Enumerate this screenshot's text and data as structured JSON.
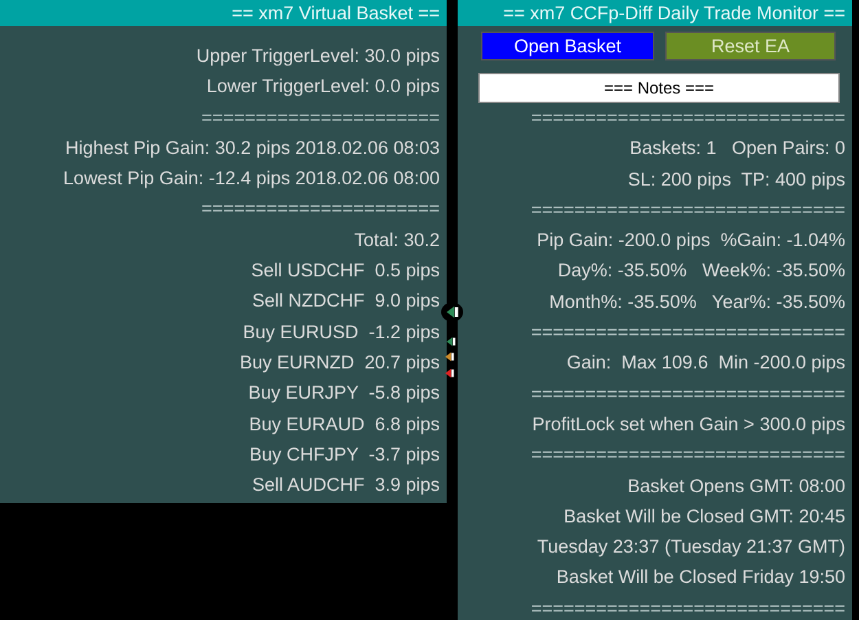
{
  "left_panel": {
    "title": "== xm7 Virtual Basket ==",
    "lines": [
      {
        "kind": "text",
        "text": "Upper TriggerLevel: 30.0 pips"
      },
      {
        "kind": "text",
        "text": "Lower TriggerLevel: 0.0 pips"
      },
      {
        "kind": "divider",
        "text": "======================"
      },
      {
        "kind": "text",
        "text": "Highest Pip Gain: 30.2 pips 2018.02.06 08:03"
      },
      {
        "kind": "text",
        "text": "Lowest Pip Gain: -12.4 pips 2018.02.06 08:00"
      },
      {
        "kind": "divider",
        "text": "======================"
      },
      {
        "kind": "text",
        "text": "Total: 30.2"
      },
      {
        "kind": "text",
        "text": "Sell USDCHF  0.5 pips"
      },
      {
        "kind": "text",
        "text": "Sell NZDCHF  9.0 pips"
      },
      {
        "kind": "text",
        "text": "Buy EURUSD  -1.2 pips"
      },
      {
        "kind": "text",
        "text": "Buy EURNZD  20.7 pips"
      },
      {
        "kind": "text",
        "text": "Buy EURJPY  -5.8 pips"
      },
      {
        "kind": "text",
        "text": "Buy EURAUD  6.8 pips"
      },
      {
        "kind": "text",
        "text": "Buy CHFJPY  -3.7 pips"
      },
      {
        "kind": "text",
        "text": "Sell AUDCHF  3.9 pips"
      }
    ]
  },
  "right_panel": {
    "title": "== xm7 CCFp-Diff Daily Trade Monitor ==",
    "buttons": [
      {
        "label": "Open Basket",
        "color": "#0000ff"
      },
      {
        "label": "Reset EA",
        "color": "#6b8e23"
      }
    ],
    "notes_button": {
      "label": "=== Notes ==="
    },
    "lines": [
      {
        "kind": "divider",
        "text": "============================="
      },
      {
        "kind": "text",
        "text": "Baskets: 1   Open Pairs: 0"
      },
      {
        "kind": "text",
        "text": "SL: 200 pips  TP: 400 pips"
      },
      {
        "kind": "divider",
        "text": "============================="
      },
      {
        "kind": "text",
        "text": "Pip Gain: -200.0 pips  %Gain: -1.04%"
      },
      {
        "kind": "text",
        "text": "Day%: -35.50%   Week%: -35.50%"
      },
      {
        "kind": "text",
        "text": "Month%: -35.50%   Year%: -35.50%"
      },
      {
        "kind": "divider",
        "text": "============================="
      },
      {
        "kind": "text",
        "text": "Gain:  Max 109.6  Min -200.0 pips"
      },
      {
        "kind": "divider",
        "text": "============================="
      },
      {
        "kind": "text",
        "text": "ProfitLock set when Gain > 300.0 pips"
      },
      {
        "kind": "divider",
        "text": "============================="
      },
      {
        "kind": "text",
        "text": "Basket Opens GMT: 08:00"
      },
      {
        "kind": "text",
        "text": "Basket Will be Closed GMT: 20:45"
      },
      {
        "kind": "text",
        "text": "Tuesday 23:37 (Tuesday 21:37 GMT)"
      },
      {
        "kind": "text",
        "text": "Basket Will be Closed Friday 19:50"
      },
      {
        "kind": "divider",
        "text": "============================="
      }
    ]
  }
}
